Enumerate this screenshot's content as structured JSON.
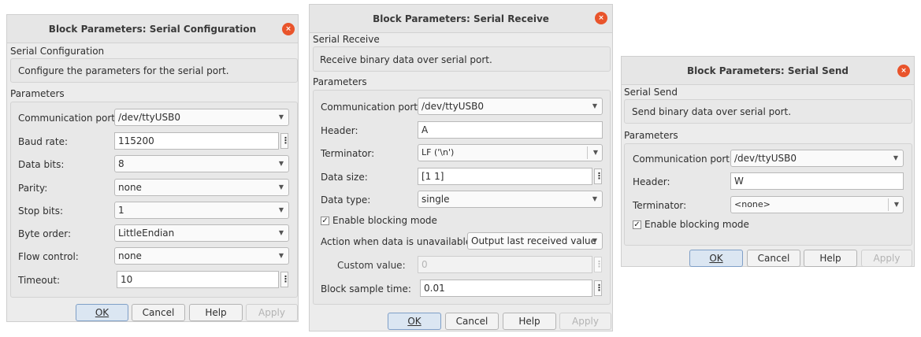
{
  "dialogs": {
    "config": {
      "title": "Block Parameters: Serial Configuration",
      "section": "Serial Configuration",
      "description": "Configure the parameters for the serial port.",
      "params_label": "Parameters",
      "fields": {
        "comm_port": {
          "label": "Communication port:",
          "value": "/dev/ttyUSB0"
        },
        "baud_rate": {
          "label": "Baud rate:",
          "value": "115200"
        },
        "data_bits": {
          "label": "Data bits:",
          "value": "8"
        },
        "parity": {
          "label": "Parity:",
          "value": "none"
        },
        "stop_bits": {
          "label": "Stop bits:",
          "value": "1"
        },
        "byte_order": {
          "label": "Byte order:",
          "value": "LittleEndian"
        },
        "flow_control": {
          "label": "Flow control:",
          "value": "none"
        },
        "timeout": {
          "label": "Timeout:",
          "value": "10"
        }
      },
      "buttons": {
        "ok": "OK",
        "cancel": "Cancel",
        "help": "Help",
        "apply": "Apply"
      }
    },
    "receive": {
      "title": "Block Parameters: Serial Receive",
      "section": "Serial Receive",
      "description": "Receive binary data over serial port.",
      "params_label": "Parameters",
      "fields": {
        "comm_port": {
          "label": "Communication port:",
          "value": "/dev/ttyUSB0"
        },
        "header": {
          "label": "Header:",
          "value": "A"
        },
        "terminator": {
          "label": "Terminator:",
          "value": "LF ('\\n')"
        },
        "data_size": {
          "label": "Data size:",
          "value": "[1  1]"
        },
        "data_type": {
          "label": "Data type:",
          "value": "single"
        },
        "blocking": {
          "label": "Enable blocking mode",
          "checked": true
        },
        "action": {
          "label": "Action when data is unavailable:",
          "value": "Output last received value"
        },
        "custom_value": {
          "label": "Custom value:",
          "value": "0"
        },
        "sample_time": {
          "label": "Block sample time:",
          "value": "0.01"
        }
      },
      "buttons": {
        "ok": "OK",
        "cancel": "Cancel",
        "help": "Help",
        "apply": "Apply"
      }
    },
    "send": {
      "title": "Block Parameters: Serial Send",
      "section": "Serial Send",
      "description": "Send binary data over serial port.",
      "params_label": "Parameters",
      "fields": {
        "comm_port": {
          "label": "Communication port:",
          "value": "/dev/ttyUSB0"
        },
        "header": {
          "label": "Header:",
          "value": "W"
        },
        "terminator": {
          "label": "Terminator:",
          "value": "<none>"
        },
        "blocking": {
          "label": "Enable blocking mode",
          "checked": true
        }
      },
      "buttons": {
        "ok": "OK",
        "cancel": "Cancel",
        "help": "Help",
        "apply": "Apply"
      }
    }
  },
  "glyphs": {
    "close": "×",
    "caret": "▼",
    "more": "⋮",
    "check": "✓"
  },
  "colors": {
    "close_button": "#e9542b",
    "default_button": "#dbe6f2",
    "dialog_bg": "#ececec"
  }
}
